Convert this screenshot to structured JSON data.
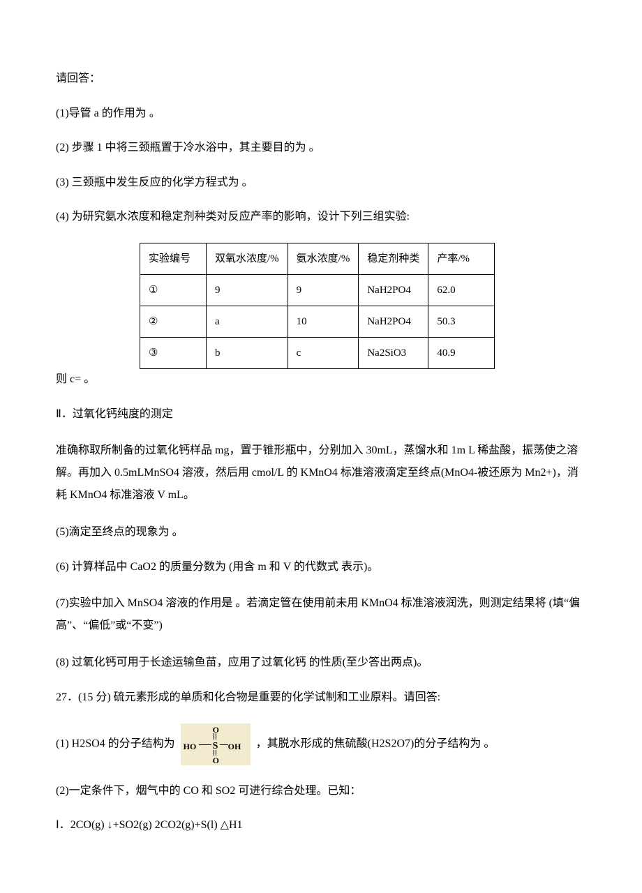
{
  "intro": "请回答：",
  "q1": "(1)导管 a 的作用为               。",
  "q2": "(2) 步骤 1 中将三颈瓶置于冷水浴中，其主要目的为               。",
  "q3": "(3) 三颈瓶中发生反应的化学方程式为               。",
  "q4_lead": "(4) 为研究氨水浓度和稳定剂种类对反应产率的影响，设计下列三组实验:",
  "table": {
    "headers": [
      "实验编号",
      "双氧水浓度/%",
      "氨水浓度/%",
      "稳定剂种类",
      "产率/%"
    ],
    "rows": [
      [
        "①",
        "9",
        "9",
        "NaH2PO4",
        "62.0"
      ],
      [
        "②",
        "a",
        "10",
        "NaH2PO4",
        "50.3"
      ],
      [
        "③",
        "b",
        "c",
        "Na2SiO3",
        "40.9"
      ]
    ]
  },
  "q4_tail": "则 c=               。",
  "section2": "Ⅱ．过氧化钙纯度的测定",
  "desc2": "准确称取所制备的过氧化钙样品 mg，置于锥形瓶中，分别加入 30mL，蒸馏水和 1m L 稀盐酸，振荡使之溶解。再加入 0.5mLMnSO4 溶液，然后用 cmol/L 的 KMnO4 标准溶液滴定至终点(MnO4-被还原为 Mn2+)，消耗 KMnO4 标准溶液 V mL。",
  "q5": "(5)滴定至终点的现象为                              。",
  "q6": "(6) 计算样品中 CaO2 的质量分数为               (用含 m 和 V 的代数式 表示)。",
  "q7": "(7)实验中加入 MnSO4 溶液的作用是               。若滴定管在使用前未用 KMnO4 标准溶液润洗，则测定结果将               (填“偏高”、“偏低”或“不变”)",
  "q8": "(8) 过氧化钙可用于长途运输鱼苗，应用了过氧化钙               的性质(至少答出两点)。",
  "q27": "27．(15 分) 硫元素形成的单质和化合物是重要的化学试制和工业原料。请回答:",
  "q27_1a": "(1) H2SO4 的分子结构为",
  "q27_1b": "，其脱水形成的焦硫酸(H2S2O7)的分子结构为               。",
  "q27_2": "(2)一定条件下，烟气中的 CO 和 SO2 可进行综合处理。已知：",
  "eqI": "Ⅰ．2CO(g) ↓+SO2(g) 2CO2(g)+S(l) △H1",
  "struct": {
    "OH_l": "HO",
    "S": "S",
    "OH_r": "OH",
    "O_top": "O",
    "O_bot": "O"
  }
}
